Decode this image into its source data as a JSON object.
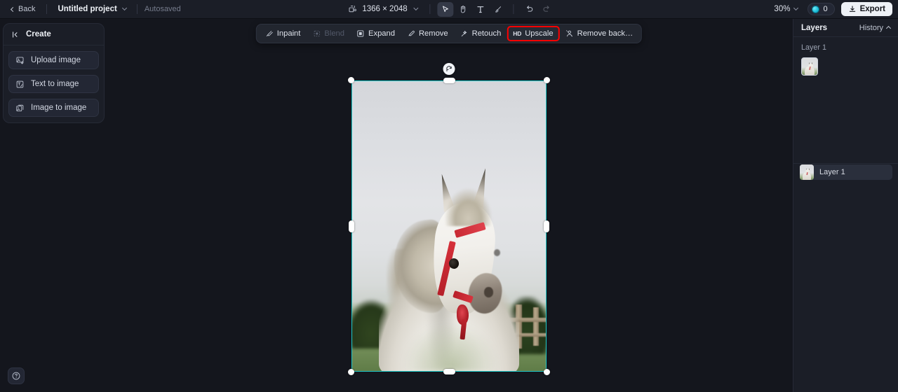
{
  "header": {
    "back_label": "Back",
    "project_name": "Untitled project",
    "autosave_label": "Autosaved",
    "canvas_size": "1366 × 2048",
    "zoom_level": "30%",
    "credits_count": "0",
    "export_label": "Export",
    "tools": [
      {
        "name": "select-tool",
        "glyph": "cursor",
        "active": true
      },
      {
        "name": "hand-tool",
        "glyph": "hand",
        "active": false
      },
      {
        "name": "text-tool",
        "glyph": "T",
        "active": false
      },
      {
        "name": "brush-tool",
        "glyph": "brush",
        "active": false
      }
    ],
    "history_tools": [
      {
        "name": "undo-button",
        "enabled": true
      },
      {
        "name": "redo-button",
        "enabled": false
      }
    ]
  },
  "sidebar": {
    "title": "Create",
    "items": [
      {
        "label": "Upload image",
        "icon": "upload-image-icon"
      },
      {
        "label": "Text to image",
        "icon": "text-to-image-icon"
      },
      {
        "label": "Image to image",
        "icon": "image-to-image-icon"
      }
    ]
  },
  "context_toolbar": {
    "items": [
      {
        "label": "Inpaint",
        "icon": "inpaint-icon",
        "state": "enabled"
      },
      {
        "label": "Blend",
        "icon": "blend-icon",
        "state": "disabled"
      },
      {
        "label": "Expand",
        "icon": "expand-icon",
        "state": "enabled"
      },
      {
        "label": "Remove",
        "icon": "remove-icon",
        "state": "enabled"
      },
      {
        "label": "Retouch",
        "icon": "retouch-icon",
        "state": "enabled"
      },
      {
        "label": "Upscale",
        "icon": "hd-icon",
        "state": "highlighted"
      },
      {
        "label": "Remove back…",
        "icon": "remove-background-icon",
        "state": "enabled"
      }
    ],
    "highlight_color": "#fe0000"
  },
  "canvas": {
    "selection_color": "#1ec8c8",
    "image_description": "white horse with red halter in a green field under overcast sky"
  },
  "right_panel": {
    "title": "Layers",
    "history_label": "History",
    "selected_layer_label": "Layer 1",
    "layers": [
      {
        "name": "Layer 1"
      }
    ]
  },
  "help": {
    "icon": "help-circle-icon"
  }
}
